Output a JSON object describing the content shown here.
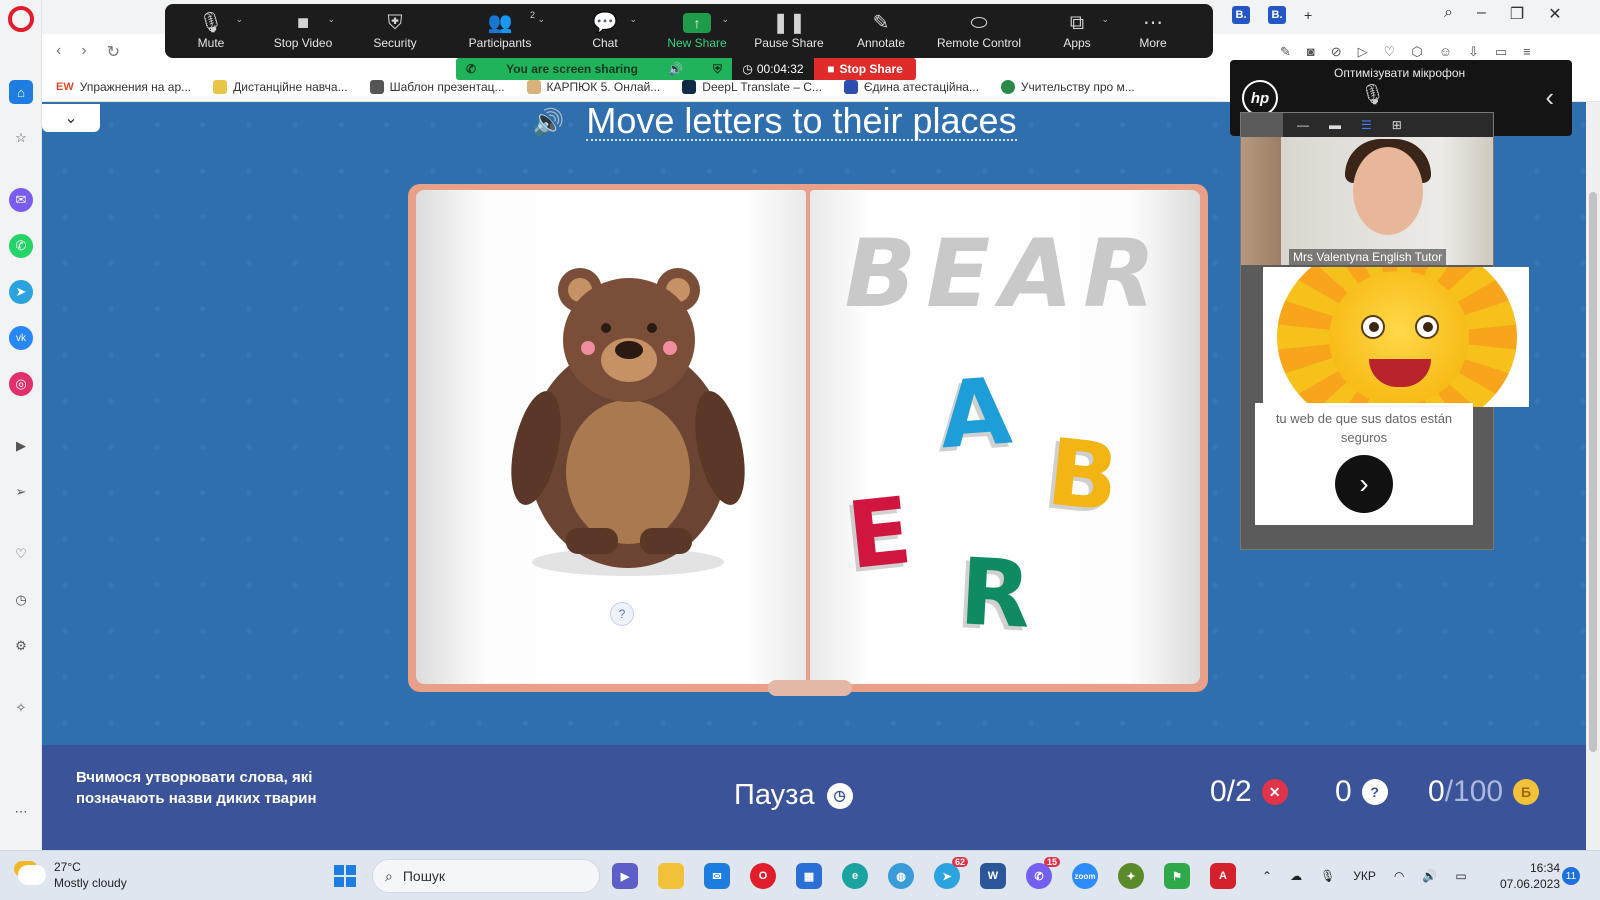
{
  "zoom": {
    "toolbar": [
      {
        "label": "Mute",
        "icon": "microphone-icon",
        "caret": true
      },
      {
        "label": "Stop Video",
        "icon": "video-camera-icon",
        "caret": true
      },
      {
        "label": "Security",
        "icon": "shield-icon",
        "caret": false
      },
      {
        "label": "Participants",
        "icon": "participants-icon",
        "caret": true,
        "badge": "2"
      },
      {
        "label": "Chat",
        "icon": "chat-bubble-icon",
        "caret": true
      },
      {
        "label": "New Share",
        "icon": "share-arrow-icon",
        "caret": true
      },
      {
        "label": "Pause Share",
        "icon": "pause-icon",
        "caret": false
      },
      {
        "label": "Annotate",
        "icon": "pencil-icon",
        "caret": false
      },
      {
        "label": "Remote Control",
        "icon": "mouse-icon",
        "caret": false
      },
      {
        "label": "Apps",
        "icon": "apps-icon",
        "caret": true
      },
      {
        "label": "More",
        "icon": "more-dots-icon",
        "caret": false
      }
    ],
    "sharing_text": "You are screen sharing",
    "timer": "00:04:32",
    "stop_share": "Stop Share",
    "video_participant": "Mrs Valentyna English Tutor"
  },
  "hp": {
    "panel_text": "Оптимізувати мікрофон",
    "logo_text": "hp"
  },
  "bookmarks": [
    {
      "label": "Упражнения на ар...",
      "prefix": "EW"
    },
    {
      "label": "Дистанційне навча..."
    },
    {
      "label": "Шаблон презентац..."
    },
    {
      "label": "КАРПЮК 5. Онлай..."
    },
    {
      "label": "DeepL Translate – С..."
    },
    {
      "label": "Єдина атестаційна..."
    },
    {
      "label": "Учительству про м..."
    }
  ],
  "exercise": {
    "title": "Move letters to their places",
    "target_word": "BEAR",
    "letters": {
      "a": "A",
      "b": "B",
      "e": "E",
      "r": "R"
    },
    "hint": "?",
    "instruction": "Вчимося утворювати слова, які позначають назви диких тварин",
    "pause": "Пауза",
    "errors": "0/2",
    "hints_used": "0",
    "score": "0",
    "score_max": "/100",
    "coin_symbol": "Б"
  },
  "ad": {
    "text": "tu web de que sus datos están seguros"
  },
  "taskbar": {
    "temperature": "27°C",
    "weather": "Mostly cloudy",
    "search_placeholder": "Пошук",
    "language": "УКР",
    "time": "16:34",
    "date": "07.06.2023",
    "telegram_badge": "62",
    "viber_badge": "15",
    "notifications": "11"
  },
  "browser": {
    "tab_badges": [
      "B.",
      "B."
    ]
  },
  "colors": {
    "page_bg": "#2f6fae",
    "bottom_bar": "#3b5398",
    "letter_a": "#1e9ed8",
    "letter_b": "#f2b513",
    "letter_e": "#d0153f",
    "letter_r": "#0f8a62",
    "zoom_green": "#21b35b",
    "stop_red": "#e02b2b"
  }
}
